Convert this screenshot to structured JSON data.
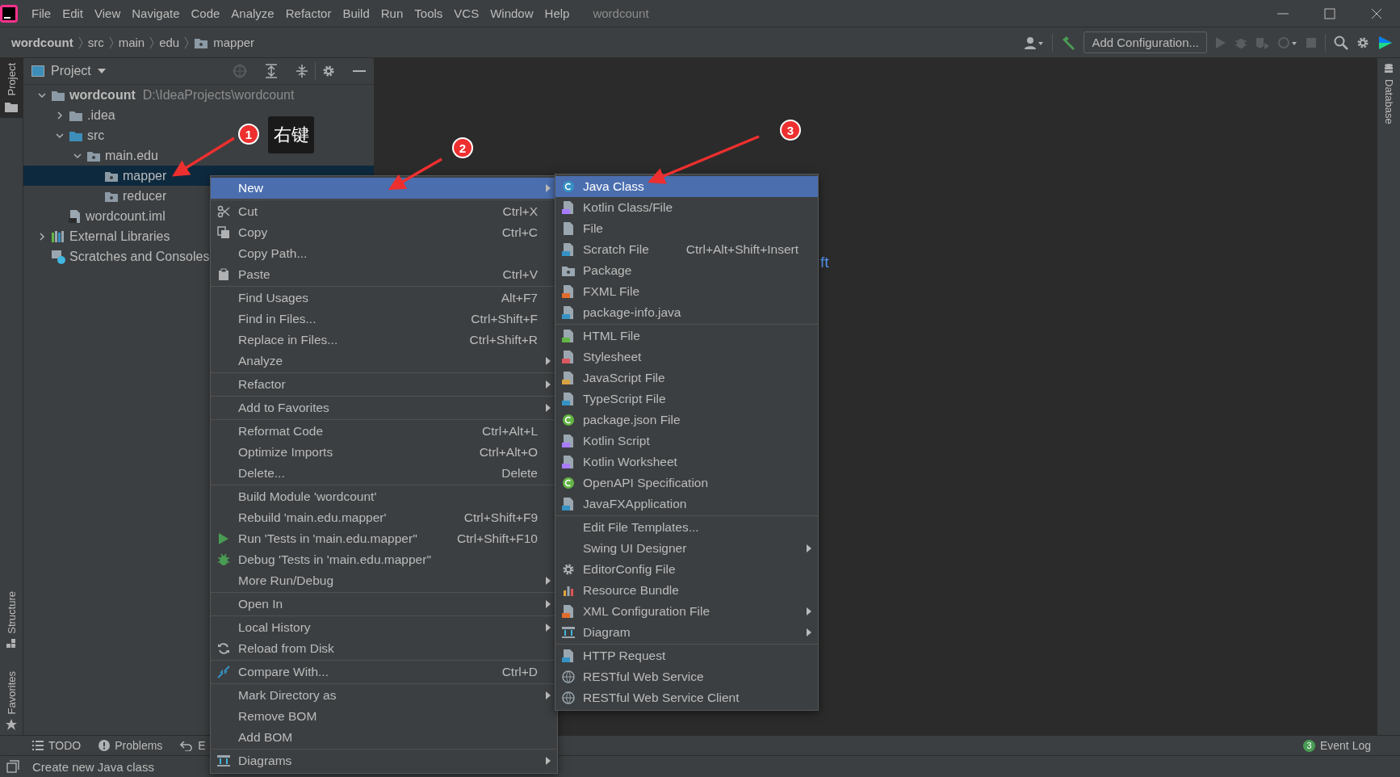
{
  "window": {
    "title": "wordcount"
  },
  "menu_bar": [
    "File",
    "Edit",
    "View",
    "Navigate",
    "Code",
    "Analyze",
    "Refactor",
    "Build",
    "Run",
    "Tools",
    "VCS",
    "Window",
    "Help"
  ],
  "breadcrumb": [
    "wordcount",
    "src",
    "main",
    "edu",
    "mapper"
  ],
  "toolbar": {
    "run_config": "Add Configuration..."
  },
  "left_stripe": [
    {
      "label": "Project",
      "selected": true
    },
    {
      "label": "Structure",
      "selected": false
    },
    {
      "label": "Favorites",
      "selected": false
    }
  ],
  "right_stripe": [
    {
      "label": "Database",
      "selected": false
    }
  ],
  "project_panel": {
    "title": "Project",
    "tree": [
      {
        "label": "wordcount",
        "detail": "D:\\IdeaProjects\\wordcount",
        "kind": "project",
        "expanded": true,
        "selected": false,
        "children": [
          {
            "label": ".idea",
            "kind": "folder",
            "expanded": false,
            "selected": false
          },
          {
            "label": "src",
            "kind": "source_folder",
            "expanded": true,
            "selected": false,
            "children": [
              {
                "label": "main.edu",
                "kind": "package",
                "expanded": true,
                "selected": false,
                "children": [
                  {
                    "label": "mapper",
                    "kind": "package",
                    "selected": true
                  },
                  {
                    "label": "reducer",
                    "kind": "package",
                    "selected": false
                  }
                ]
              }
            ]
          },
          {
            "label": "wordcount.iml",
            "kind": "file",
            "selected": false
          }
        ]
      },
      {
        "label": "External Libraries",
        "kind": "libraries",
        "expanded": false,
        "selected": false
      },
      {
        "label": "Scratches and Consoles",
        "kind": "scratches",
        "selected": false
      }
    ]
  },
  "editor": {
    "hint_fragment": "ft"
  },
  "context_menu": {
    "groups": [
      {
        "items": [
          {
            "label": "New",
            "submenu": true,
            "selected": true
          }
        ]
      },
      {
        "items": [
          {
            "label": "Cut",
            "shortcut": "Ctrl+X",
            "submenu": false,
            "selected": false
          },
          {
            "label": "Copy",
            "shortcut": "Ctrl+C",
            "submenu": false,
            "selected": false
          },
          {
            "label": "Copy Path...",
            "submenu": false,
            "selected": false
          },
          {
            "label": "Paste",
            "shortcut": "Ctrl+V",
            "submenu": false,
            "selected": false
          }
        ]
      },
      {
        "items": [
          {
            "label": "Find Usages",
            "shortcut": "Alt+F7",
            "submenu": false,
            "selected": false
          },
          {
            "label": "Find in Files...",
            "shortcut": "Ctrl+Shift+F",
            "submenu": false,
            "selected": false
          },
          {
            "label": "Replace in Files...",
            "shortcut": "Ctrl+Shift+R",
            "submenu": false,
            "selected": false
          },
          {
            "label": "Analyze",
            "submenu": true,
            "selected": false
          }
        ]
      },
      {
        "items": [
          {
            "label": "Refactor",
            "submenu": true,
            "selected": false
          }
        ]
      },
      {
        "items": [
          {
            "label": "Add to Favorites",
            "submenu": true,
            "selected": false
          }
        ]
      },
      {
        "items": [
          {
            "label": "Reformat Code",
            "shortcut": "Ctrl+Alt+L",
            "submenu": false,
            "selected": false
          },
          {
            "label": "Optimize Imports",
            "shortcut": "Ctrl+Alt+O",
            "submenu": false,
            "selected": false
          },
          {
            "label": "Delete...",
            "shortcut": "Delete",
            "submenu": false,
            "selected": false
          }
        ]
      },
      {
        "items": [
          {
            "label": "Build Module 'wordcount'",
            "submenu": false,
            "selected": false
          },
          {
            "label": "Rebuild 'main.edu.mapper'",
            "shortcut": "Ctrl+Shift+F9",
            "submenu": false,
            "selected": false
          },
          {
            "label": "Run 'Tests in 'main.edu.mapper''",
            "shortcut": "Ctrl+Shift+F10",
            "submenu": false,
            "selected": false
          },
          {
            "label": "Debug 'Tests in 'main.edu.mapper''",
            "submenu": false,
            "selected": false
          },
          {
            "label": "More Run/Debug",
            "submenu": true,
            "selected": false
          }
        ]
      },
      {
        "items": [
          {
            "label": "Open In",
            "submenu": true,
            "selected": false
          }
        ]
      },
      {
        "items": [
          {
            "label": "Local History",
            "submenu": true,
            "selected": false
          },
          {
            "label": "Reload from Disk",
            "submenu": false,
            "selected": false
          }
        ]
      },
      {
        "items": [
          {
            "label": "Compare With...",
            "shortcut": "Ctrl+D",
            "submenu": false,
            "selected": false
          }
        ]
      },
      {
        "items": [
          {
            "label": "Mark Directory as",
            "submenu": true,
            "selected": false
          },
          {
            "label": "Remove BOM",
            "submenu": false,
            "selected": false
          },
          {
            "label": "Add BOM",
            "submenu": false,
            "selected": false
          }
        ]
      },
      {
        "items": [
          {
            "label": "Diagrams",
            "submenu": true,
            "selected": false
          }
        ]
      }
    ]
  },
  "new_submenu": {
    "groups": [
      {
        "items": [
          {
            "label": "Java Class",
            "submenu": false,
            "selected": true
          },
          {
            "label": "Kotlin Class/File",
            "submenu": false,
            "selected": false
          },
          {
            "label": "File",
            "submenu": false,
            "selected": false
          },
          {
            "label": "Scratch File",
            "shortcut": "Ctrl+Alt+Shift+Insert",
            "submenu": false,
            "selected": false
          },
          {
            "label": "Package",
            "submenu": false,
            "selected": false
          },
          {
            "label": "FXML File",
            "submenu": false,
            "selected": false
          },
          {
            "label": "package-info.java",
            "submenu": false,
            "selected": false
          }
        ]
      },
      {
        "items": [
          {
            "label": "HTML File",
            "submenu": false,
            "selected": false
          },
          {
            "label": "Stylesheet",
            "submenu": false,
            "selected": false
          },
          {
            "label": "JavaScript File",
            "submenu": false,
            "selected": false
          },
          {
            "label": "TypeScript File",
            "submenu": false,
            "selected": false
          },
          {
            "label": "package.json File",
            "submenu": false,
            "selected": false
          },
          {
            "label": "Kotlin Script",
            "submenu": false,
            "selected": false
          },
          {
            "label": "Kotlin Worksheet",
            "submenu": false,
            "selected": false
          },
          {
            "label": "OpenAPI Specification",
            "submenu": false,
            "selected": false
          },
          {
            "label": "JavaFXApplication",
            "submenu": false,
            "selected": false
          }
        ]
      },
      {
        "items": [
          {
            "label": "Edit File Templates...",
            "submenu": false,
            "selected": false
          },
          {
            "label": "Swing UI Designer",
            "submenu": true,
            "selected": false
          },
          {
            "label": "EditorConfig File",
            "submenu": false,
            "selected": false
          },
          {
            "label": "Resource Bundle",
            "submenu": false,
            "selected": false
          },
          {
            "label": "XML Configuration File",
            "submenu": true,
            "selected": false
          },
          {
            "label": "Diagram",
            "submenu": true,
            "selected": false
          }
        ]
      },
      {
        "items": [
          {
            "label": "HTTP Request",
            "submenu": false,
            "selected": false
          },
          {
            "label": "RESTful Web Service",
            "submenu": false,
            "selected": false
          },
          {
            "label": "RESTful Web Service Client",
            "submenu": false,
            "selected": false
          }
        ]
      }
    ]
  },
  "bottom_tools": [
    {
      "label": "TODO"
    },
    {
      "label": "Problems"
    },
    {
      "label": "E"
    }
  ],
  "event_log": {
    "count": "3",
    "label": "Event Log"
  },
  "status_bar": {
    "message": "Create new Java class"
  },
  "annotations": {
    "steps": [
      "1",
      "2",
      "3"
    ],
    "callout": "右键"
  }
}
